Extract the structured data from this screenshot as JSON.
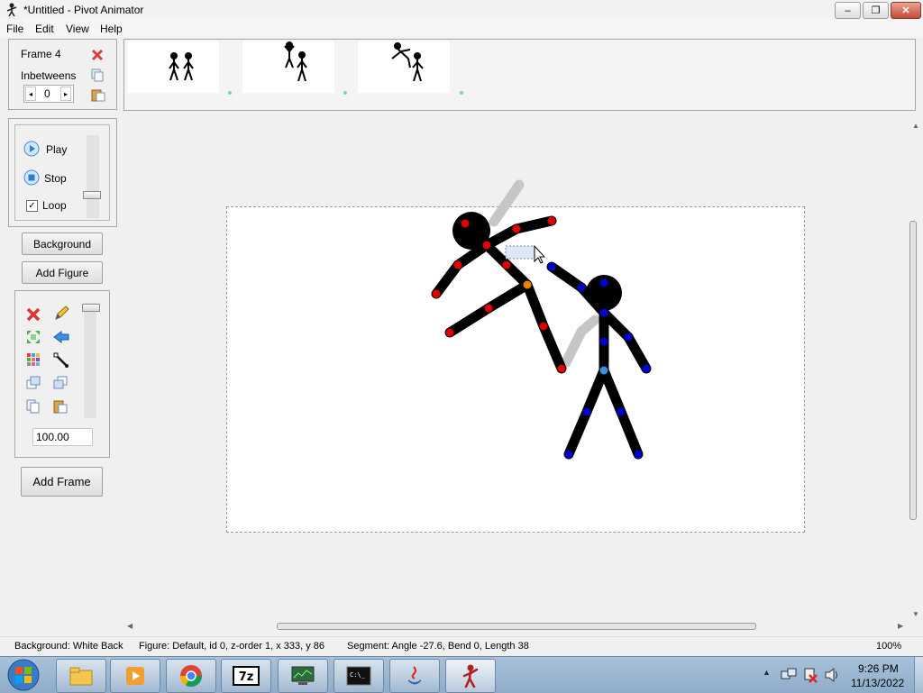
{
  "window": {
    "title": "*Untitled - Pivot Animator"
  },
  "menu": [
    "File",
    "Edit",
    "View",
    "Help"
  ],
  "frame_panel": {
    "frame_label": "Frame 4",
    "inbetweens_label": "Inbetweens",
    "inbetweens_value": "0"
  },
  "playback": {
    "play": "Play",
    "stop": "Stop",
    "loop": "Loop",
    "loop_checked": true
  },
  "buttons": {
    "background": "Background",
    "add_figure": "Add Figure",
    "add_frame": "Add Frame"
  },
  "tools": {
    "scale_value": "100.00"
  },
  "status": {
    "background": "Background: White Back",
    "figure": "Figure: Default,  id 0,  z-order 1,  x 333, y 86",
    "segment": "Segment: Angle -27.6,  Bend 0,  Length 38",
    "zoom": "100%"
  },
  "clock": {
    "time": "9:26 PM",
    "date": "11/13/2022"
  },
  "colors": {
    "red_joint": "#e00000",
    "blue_joint": "#0000cc",
    "orange_joint": "#f08000",
    "light_blue_joint": "#3a8fe0",
    "onion_skin": "#c0c0c0"
  }
}
